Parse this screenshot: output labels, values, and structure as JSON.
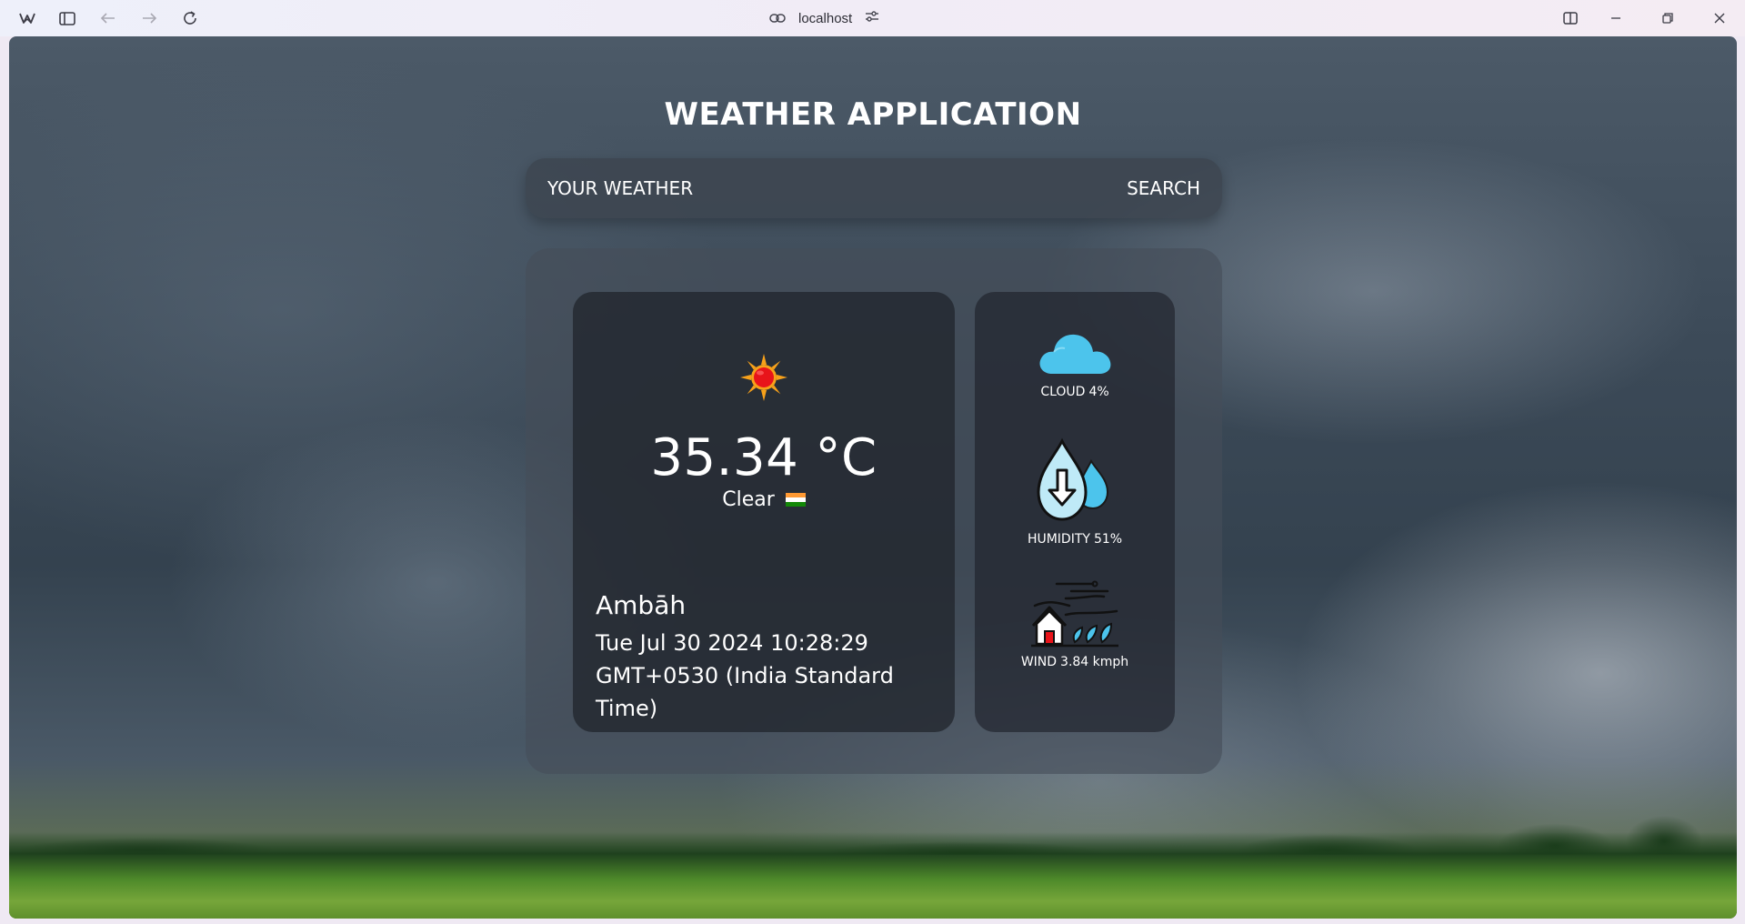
{
  "browser": {
    "url": "localhost",
    "icons": [
      "browser-logo-icon",
      "sidebar-toggle-icon",
      "back-arrow-icon",
      "forward-arrow-icon",
      "reload-icon",
      "link-icon",
      "site-settings-icon",
      "split-view-icon",
      "minimize-icon",
      "restore-icon",
      "close-icon"
    ]
  },
  "app": {
    "title": "WEATHER APPLICATION",
    "search": {
      "placeholder": "YOUR WEATHER",
      "button_label": "SEARCH"
    },
    "current": {
      "icon": "sun-icon",
      "temperature": "35.34 °C",
      "condition": "Clear",
      "flag": "india-flag-icon",
      "city": "Ambāh",
      "datetime_line1": "Tue Jul 30 2024 10:28:29",
      "datetime_line2": "GMT+0530 (India Standard Time)"
    },
    "stats": {
      "cloud": {
        "label": "CLOUD",
        "value": "4%",
        "icon": "cloud-icon"
      },
      "humidity": {
        "label": "HUMIDITY",
        "value": "51%",
        "icon": "humidity-drops-icon"
      },
      "wind": {
        "label": "WIND",
        "value": "3.84 kmph",
        "icon": "wind-house-icon"
      }
    }
  },
  "colors": {
    "cloud_blue": "#4cc4ec",
    "drop_fill": "#bfeaf7",
    "sun_core": "#e8141a",
    "sun_rays": "#f7a11a",
    "flag_saffron": "#ff9933",
    "flag_green": "#138808"
  }
}
